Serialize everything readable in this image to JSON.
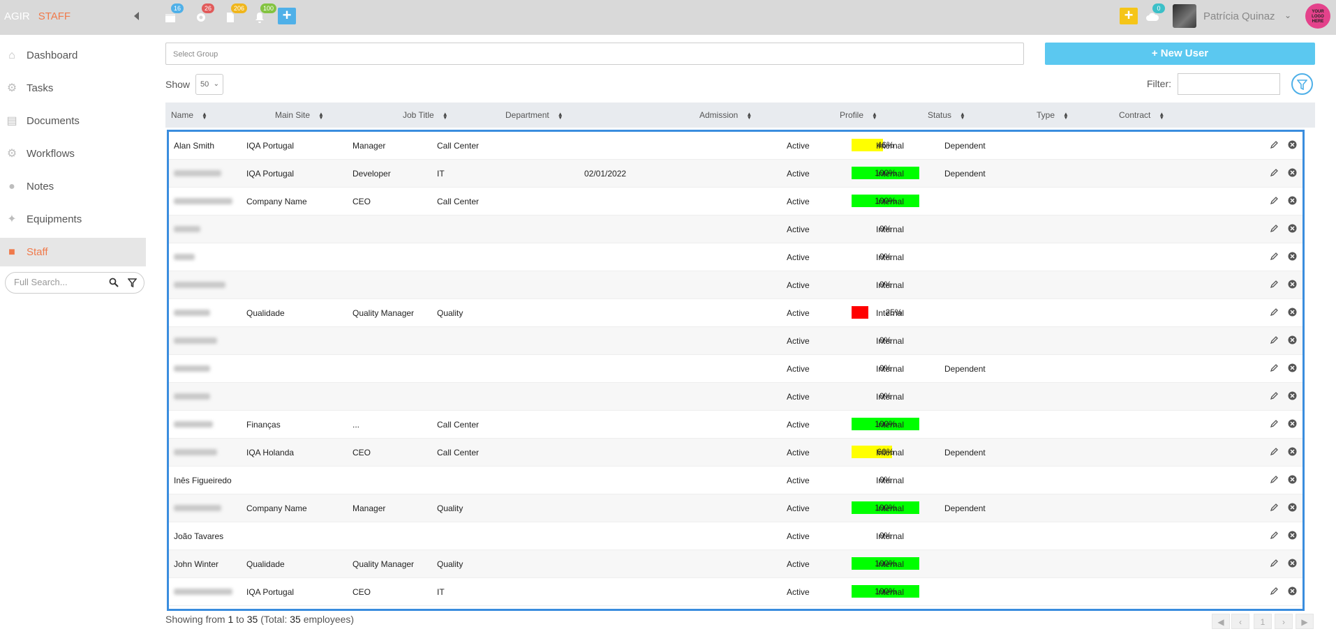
{
  "app": {
    "name": "AGIR",
    "module": "STAFF"
  },
  "topbar": {
    "badges": {
      "calendar": "16",
      "settings": "26",
      "documents": "206",
      "notifications": "100",
      "messages": "0"
    },
    "user_name": "Patrícia Quinaz",
    "logo_text": "YOUR LOGO HERE",
    "colors": {
      "yellow_button": "#f5c518",
      "blue_button": "#4fb0e8"
    }
  },
  "sidebar": {
    "items": [
      {
        "label": "Dashboard",
        "icon": "home-icon"
      },
      {
        "label": "Tasks",
        "icon": "gear-icon"
      },
      {
        "label": "Documents",
        "icon": "document-icon"
      },
      {
        "label": "Workflows",
        "icon": "gears-icon"
      },
      {
        "label": "Notes",
        "icon": "chat-icon"
      },
      {
        "label": "Equipments",
        "icon": "wrench-icon"
      },
      {
        "label": "Staff",
        "icon": "user-icon"
      }
    ],
    "search_placeholder": "Full Search..."
  },
  "controls": {
    "group_placeholder": "Select Group",
    "new_user_label": "New User",
    "show_label": "Show",
    "show_value": "50",
    "filter_label": "Filter:"
  },
  "table": {
    "headers": [
      "Name",
      "Main Site",
      "Job Title",
      "Department",
      "Admission",
      "Profile",
      "Status",
      "Type",
      "Contract"
    ],
    "rows": [
      {
        "name": "Alan Smith",
        "name_blurred": false,
        "site": "IQA Portugal",
        "job": "Manager",
        "dept": "Call Center",
        "admission": "",
        "profile": 46,
        "profile_label": "46%",
        "status": "Active",
        "type": "Internal",
        "contract": "Dependent"
      },
      {
        "name": "",
        "name_blurred": true,
        "site": "IQA Portugal",
        "job": "Developer",
        "dept": "IT",
        "admission": "02/01/2022",
        "profile": 100,
        "profile_label": "100%",
        "status": "Active",
        "type": "Internal",
        "contract": "Dependent"
      },
      {
        "name": "",
        "name_blurred": true,
        "site": "Company Name",
        "job": "CEO",
        "dept": "Call Center",
        "admission": "",
        "profile": 100,
        "profile_label": "100%",
        "status": "Active",
        "type": "Internal",
        "contract": ""
      },
      {
        "name": "",
        "name_blurred": true,
        "site": "",
        "job": "",
        "dept": "",
        "admission": "",
        "profile": 0,
        "profile_label": "0%",
        "status": "Active",
        "type": "Internal",
        "contract": ""
      },
      {
        "name": "",
        "name_blurred": true,
        "site": "",
        "job": "",
        "dept": "",
        "admission": "",
        "profile": 0,
        "profile_label": "0%",
        "status": "Active",
        "type": "Internal",
        "contract": ""
      },
      {
        "name": "",
        "name_blurred": true,
        "site": "",
        "job": "",
        "dept": "",
        "admission": "",
        "profile": 0,
        "profile_label": "0%",
        "status": "Active",
        "type": "Internal",
        "contract": ""
      },
      {
        "name": "",
        "name_blurred": true,
        "site": "Qualidade",
        "job": "Quality Manager",
        "dept": "Quality",
        "admission": "",
        "profile": 25,
        "profile_label": "25%",
        "status": "Active",
        "type": "Internal",
        "contract": ""
      },
      {
        "name": "",
        "name_blurred": true,
        "site": "",
        "job": "",
        "dept": "",
        "admission": "",
        "profile": 0,
        "profile_label": "0%",
        "status": "Active",
        "type": "Internal",
        "contract": ""
      },
      {
        "name": "",
        "name_blurred": true,
        "site": "",
        "job": "",
        "dept": "",
        "admission": "",
        "profile": 0,
        "profile_label": "0%",
        "status": "Active",
        "type": "Internal",
        "contract": "Dependent"
      },
      {
        "name": "",
        "name_blurred": true,
        "site": "",
        "job": "",
        "dept": "",
        "admission": "",
        "profile": 0,
        "profile_label": "0%",
        "status": "Active",
        "type": "Internal",
        "contract": ""
      },
      {
        "name": "",
        "name_blurred": true,
        "site": "Finanças",
        "job": "...",
        "dept": "Call Center",
        "admission": "",
        "profile": 100,
        "profile_label": "100%",
        "status": "Active",
        "type": "Internal",
        "contract": ""
      },
      {
        "name": "",
        "name_blurred": true,
        "site": "IQA Holanda",
        "job": "CEO",
        "dept": "Call Center",
        "admission": "",
        "profile": 60,
        "profile_label": "60%",
        "status": "Active",
        "type": "Internal",
        "contract": "Dependent"
      },
      {
        "name": "Inês Figueiredo",
        "name_blurred": false,
        "site": "",
        "job": "",
        "dept": "",
        "admission": "",
        "profile": 0,
        "profile_label": "0%",
        "status": "Active",
        "type": "Internal",
        "contract": ""
      },
      {
        "name": "",
        "name_blurred": true,
        "site": "Company Name",
        "job": "Manager",
        "dept": "Quality",
        "admission": "",
        "profile": 100,
        "profile_label": "100%",
        "status": "Active",
        "type": "Internal",
        "contract": "Dependent"
      },
      {
        "name": "João Tavares",
        "name_blurred": false,
        "site": "",
        "job": "",
        "dept": "",
        "admission": "",
        "profile": 0,
        "profile_label": "0%",
        "status": "Active",
        "type": "Internal",
        "contract": ""
      },
      {
        "name": "John Winter",
        "name_blurred": false,
        "site": "Qualidade",
        "job": "Quality Manager",
        "dept": "Quality",
        "admission": "",
        "profile": 100,
        "profile_label": "100%",
        "status": "Active",
        "type": "Internal",
        "contract": ""
      },
      {
        "name": "",
        "name_blurred": true,
        "site": "IQA Portugal",
        "job": "CEO",
        "dept": "IT",
        "admission": "",
        "profile": 100,
        "profile_label": "100%",
        "status": "Active",
        "type": "Internal",
        "contract": ""
      }
    ],
    "profile_colors": {
      "full": "#00ff00",
      "partial": "#ffff00",
      "low": "#ff0000"
    }
  },
  "footer": {
    "showing_prefix": "Showing from",
    "from": "1",
    "to_word": "to",
    "to": "35",
    "total_prefix": "(Total:",
    "total": "35",
    "total_suffix": "employees)",
    "current_page": "1"
  }
}
